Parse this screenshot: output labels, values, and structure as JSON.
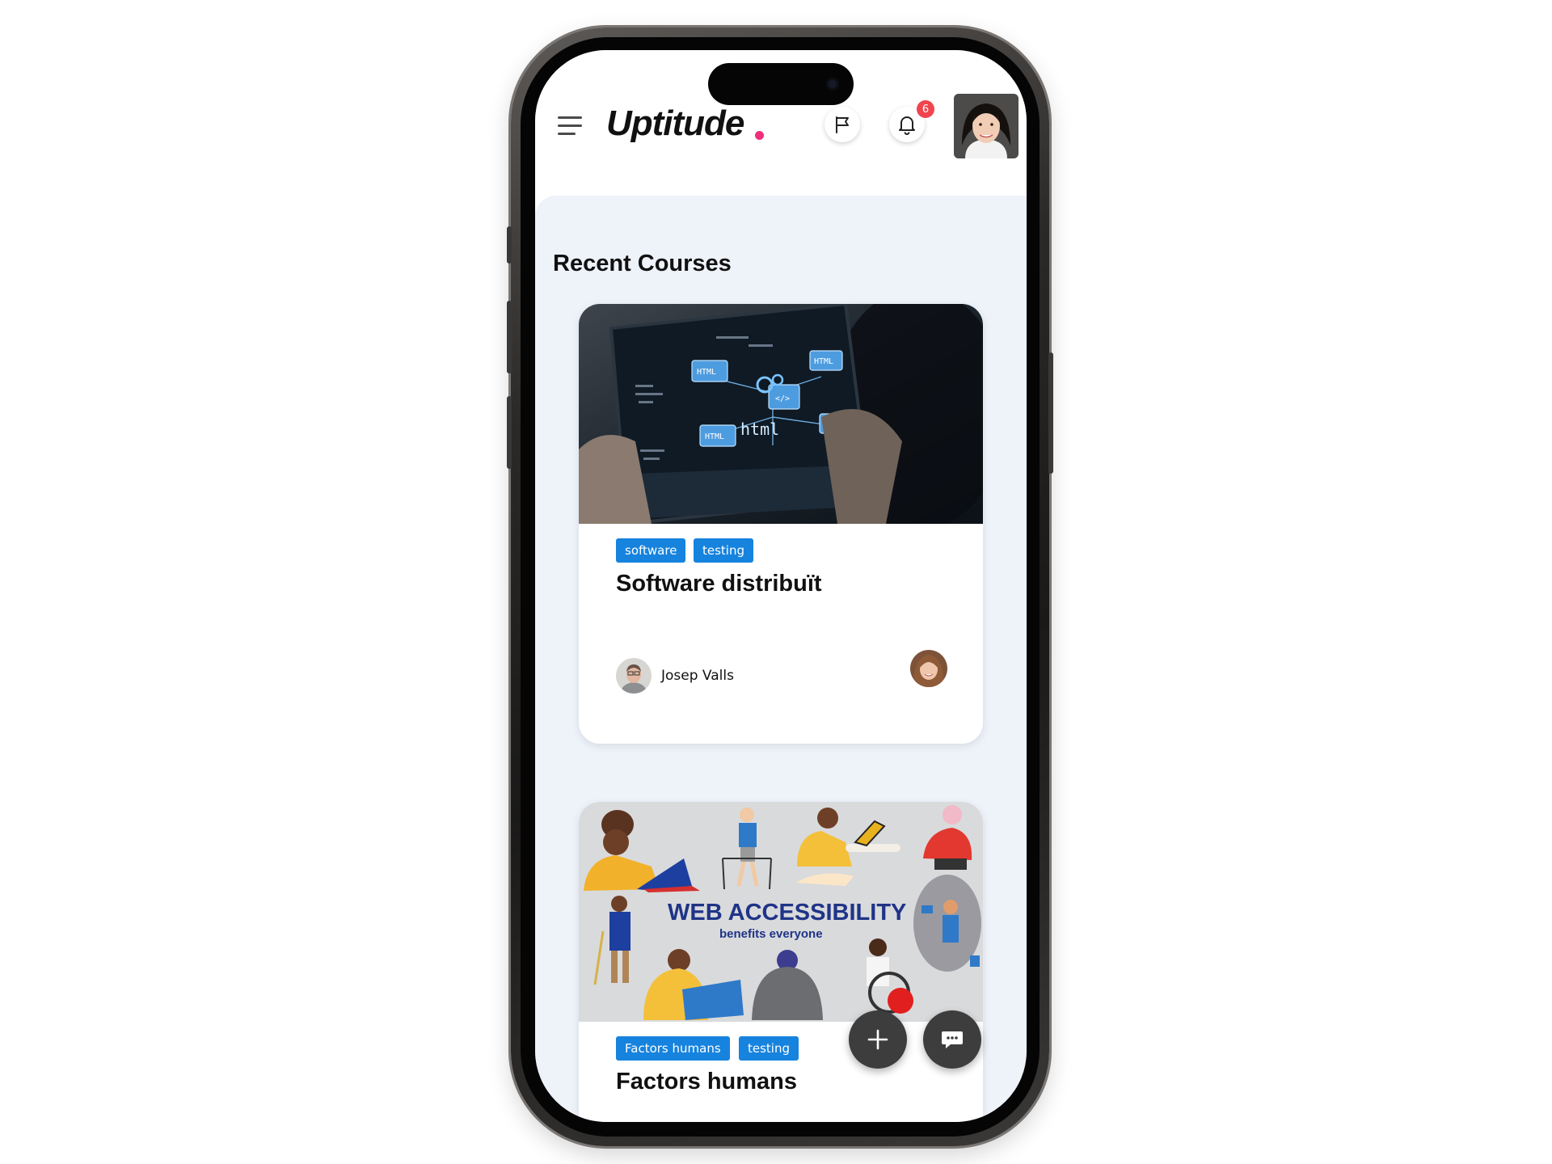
{
  "app": {
    "logo": "Uptitude",
    "brand_dot_color": "#ef2f7a",
    "notification_count": "6"
  },
  "header": {
    "menu_icon": "hamburger-menu-icon",
    "flag_icon": "flag-icon",
    "bell_icon": "bell-icon"
  },
  "main": {
    "section_title": "Recent Courses",
    "courses": [
      {
        "image_code_label": "html",
        "tags": [
          "software",
          "testing"
        ],
        "title": "Software distribuït",
        "author": "Josep Valls"
      },
      {
        "image_caption": "WEB ACCESSIBILITY",
        "image_subcaption": "benefits everyone",
        "tags": [
          "Factors humans",
          "testing"
        ],
        "title": "Factors humans"
      }
    ]
  },
  "fabs": {
    "add_icon": "plus-icon",
    "chat_icon": "chat-bubble-icon"
  },
  "colors": {
    "tag": "#1683de",
    "content_bg": "#eef2f9",
    "fab": "#3d3d3d",
    "badge": "#f0454e"
  }
}
